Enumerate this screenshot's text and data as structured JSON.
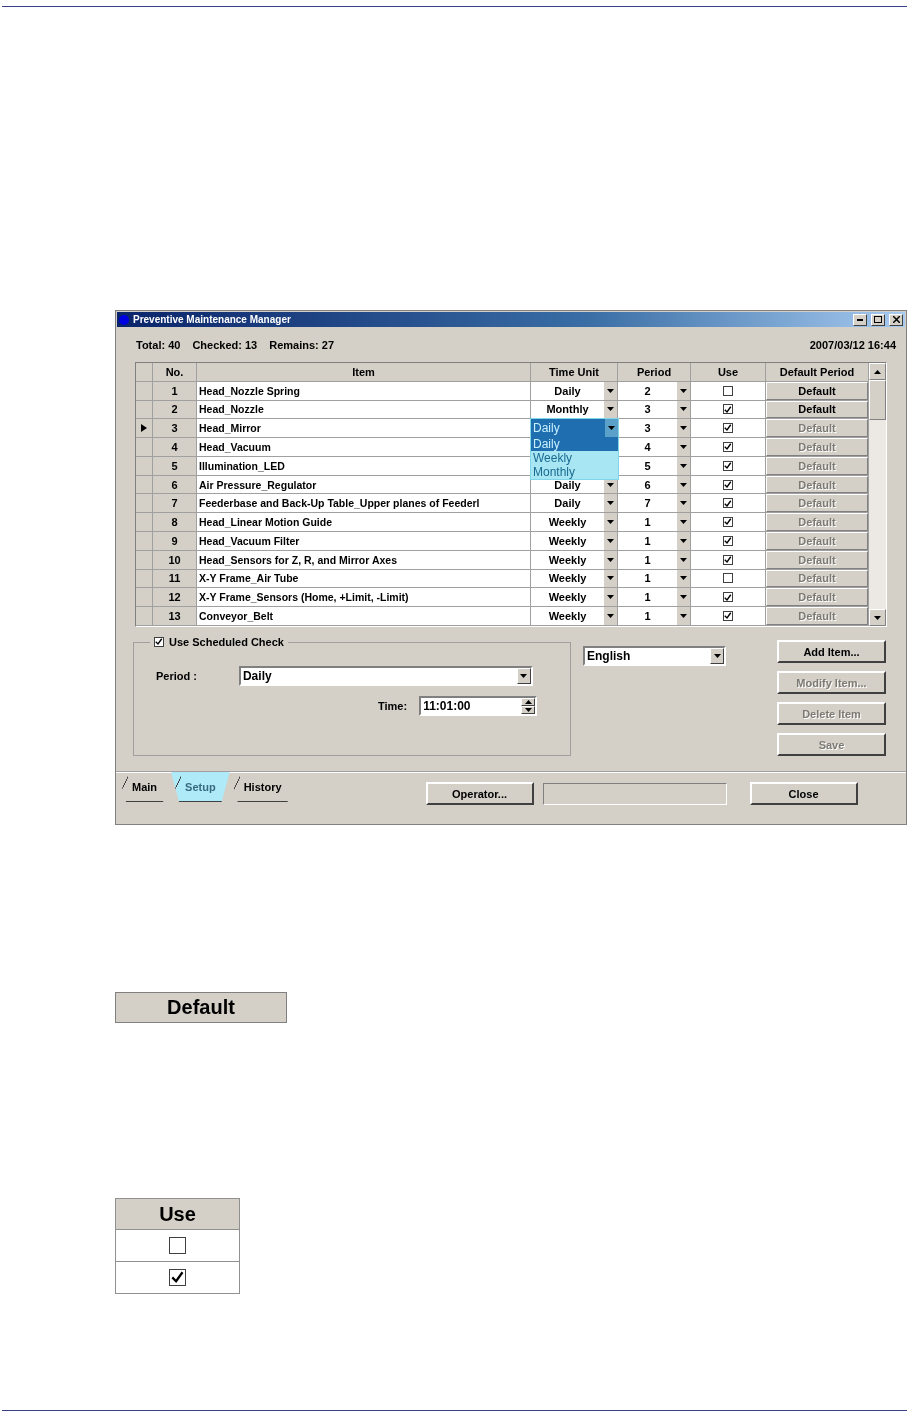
{
  "window": {
    "title": "Preventive Maintenance Manager"
  },
  "summary": {
    "total": "Total: 40",
    "checked": "Checked: 13",
    "remains": "Remains: 27",
    "datetime": "2007/03/12 16:44"
  },
  "table": {
    "columns": [
      "No.",
      "Item",
      "Time Unit",
      "Period",
      "Use",
      "Default Period"
    ],
    "rows": [
      {
        "selected": false,
        "no": "1",
        "item": "Head_Nozzle Spring",
        "time_unit": "Daily",
        "period": "2",
        "use": false,
        "default_button": {
          "label": "Default",
          "disabled": false
        }
      },
      {
        "selected": false,
        "no": "2",
        "item": "Head_Nozzle",
        "time_unit": "Monthly",
        "period": "3",
        "use": true,
        "default_button": {
          "label": "Default",
          "disabled": false
        }
      },
      {
        "selected": true,
        "no": "3",
        "item": "Head_Mirror",
        "time_unit": "Daily",
        "time_unit_options": [
          {
            "label": "Daily",
            "selected": true
          },
          {
            "label": "Weekly",
            "selected": false
          },
          {
            "label": "Monthly",
            "selected": false
          }
        ],
        "period": "3",
        "use": true,
        "default_button": {
          "label": "Default",
          "disabled": true
        }
      },
      {
        "selected": false,
        "no": "4",
        "item": "Head_Vacuum",
        "period": "4",
        "use": true,
        "default_button": {
          "label": "Default",
          "disabled": true
        }
      },
      {
        "selected": false,
        "no": "5",
        "item": "Illumination_LED",
        "period": "5",
        "use": true,
        "default_button": {
          "label": "Default",
          "disabled": true
        }
      },
      {
        "selected": false,
        "no": "6",
        "item": "Air Pressure_Regulator",
        "time_unit": "Daily",
        "period": "6",
        "use": true,
        "default_button": {
          "label": "Default",
          "disabled": true
        }
      },
      {
        "selected": false,
        "no": "7",
        "item": "Feederbase and Back-Up Table_Upper planes of Feederl",
        "time_unit": "Daily",
        "period": "7",
        "use": true,
        "default_button": {
          "label": "Default",
          "disabled": true
        }
      },
      {
        "selected": false,
        "no": "8",
        "item": "Head_Linear Motion Guide",
        "time_unit": "Weekly",
        "period": "1",
        "use": true,
        "default_button": {
          "label": "Default",
          "disabled": true
        }
      },
      {
        "selected": false,
        "no": "9",
        "item": "Head_Vacuum Filter",
        "time_unit": "Weekly",
        "period": "1",
        "use": true,
        "default_button": {
          "label": "Default",
          "disabled": true
        }
      },
      {
        "selected": false,
        "no": "10",
        "item": "Head_Sensors for Z, R, and Mirror Axes",
        "time_unit": "Weekly",
        "period": "1",
        "use": true,
        "default_button": {
          "label": "Default",
          "disabled": true
        }
      },
      {
        "selected": false,
        "no": "11",
        "item": "X-Y Frame_Air Tube",
        "time_unit": "Weekly",
        "period": "1",
        "use": false,
        "default_button": {
          "label": "Default",
          "disabled": true
        }
      },
      {
        "selected": false,
        "no": "12",
        "item": "X-Y Frame_Sensors (Home, +Limit, -Limit)",
        "time_unit": "Weekly",
        "period": "1",
        "use": true,
        "default_button": {
          "label": "Default",
          "disabled": true
        }
      },
      {
        "selected": false,
        "no": "13",
        "item": "Conveyor_Belt",
        "time_unit": "Weekly",
        "period": "1",
        "use": true,
        "default_button": {
          "label": "Default",
          "disabled": true
        }
      }
    ]
  },
  "scheduled": {
    "label": "Use Scheduled Check",
    "checked": true,
    "period_label": "Period :",
    "period": "Daily",
    "time_label": "Time:",
    "time": "11:01:00"
  },
  "language": "English",
  "side_buttons": [
    {
      "label": "Add Item...",
      "disabled": false
    },
    {
      "label": "Modify Item...",
      "disabled": true
    },
    {
      "label": "Delete Item",
      "disabled": true
    },
    {
      "label": "Save",
      "disabled": true
    }
  ],
  "tabs": [
    {
      "label": "Main",
      "selected": false
    },
    {
      "label": "Setup",
      "selected": true
    },
    {
      "label": "History",
      "selected": false
    }
  ],
  "footer": {
    "operator_button": "Operator...",
    "close_button": "Close"
  },
  "examples": {
    "default_button": "Default",
    "use_table": {
      "header": "Use",
      "rows": [
        {
          "checked": false
        },
        {
          "checked": true
        }
      ]
    }
  }
}
